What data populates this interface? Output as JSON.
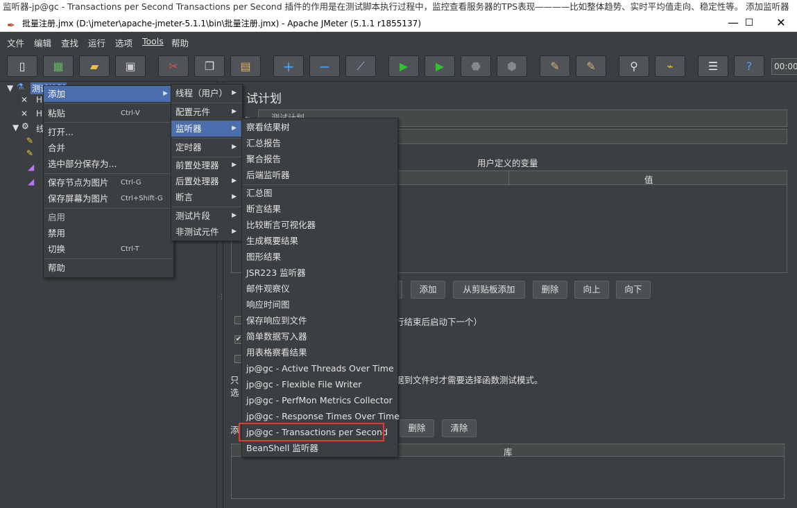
{
  "caption": "监听器-jp@gc - Transactions per Second Transactions per Second 插件的作用是在测试脚本执行过程中，监控查看服务器的TPS表现————比如整体趋势、实时平均值走向、稳定性等。 添加监听器",
  "window": {
    "title": "批量注册.jmx (D:\\jmeter\\apache-jmeter-5.1.1\\bin\\批量注册.jmx) - Apache JMeter (5.1.1 r1855137)",
    "minimize": "—",
    "maximize": "☐",
    "close": "✕"
  },
  "menubar": [
    "文件",
    "编辑",
    "查找",
    "运行",
    "选项",
    "Tools",
    "帮助"
  ],
  "toolbar": {
    "icons": [
      "new-icon",
      "templates-icon",
      "open-icon",
      "save-icon",
      "cut-icon",
      "copy-icon",
      "paste-icon",
      "expand-icon",
      "collapse-icon",
      "toggle-icon",
      "start-icon",
      "start-no-pause-icon",
      "stop-icon",
      "shutdown-icon",
      "clear-icon",
      "clear-all-icon",
      "search-icon",
      "reset-search-icon",
      "function-helper-icon",
      "help-icon"
    ],
    "timer": "00:00:"
  },
  "tree": {
    "root": "测试计划",
    "nodes": [
      "H",
      "H",
      "线",
      "",
      "",
      "",
      ""
    ]
  },
  "right": {
    "title": "试计划",
    "name_label": "名：",
    "name_value": "测试计划",
    "vars_title": "用户定义的变量",
    "vars_value_col": "值",
    "buttons": [
      "添加",
      "从剪贴板添加",
      "删除",
      "向上",
      "向下"
    ],
    "run_text": "行结束后启动下一个）",
    "func_text": "据到文件时才需要选择函数测试模式。",
    "only_char": "只",
    "select_char": "选",
    "add_char": "添",
    "lib_buttons": [
      "删除",
      "清除"
    ],
    "lib_col": "库"
  },
  "menu1": {
    "items": [
      {
        "label": "添加",
        "arrow": "▶",
        "selected": true
      },
      {
        "label": "粘贴",
        "accel": "Ctrl-V"
      },
      {
        "label": "打开..."
      },
      {
        "label": "合并"
      },
      {
        "label": "选中部分保存为..."
      },
      {
        "label": "保存节点为图片",
        "accel": "Ctrl-G"
      },
      {
        "label": "保存屏幕为图片",
        "accel": "Ctrl+Shift-G"
      },
      {
        "label": "启用",
        "dim": true
      },
      {
        "label": "禁用"
      },
      {
        "label": "切换",
        "accel": "Ctrl-T"
      },
      {
        "label": "帮助"
      }
    ]
  },
  "menu2": {
    "items": [
      {
        "label": "线程（用户）",
        "arrow": "▶"
      },
      {
        "label": "配置元件",
        "arrow": "▶"
      },
      {
        "label": "监听器",
        "arrow": "▶",
        "selected": true
      },
      {
        "label": "定时器",
        "arrow": "▶"
      },
      {
        "label": "前置处理器",
        "arrow": "▶"
      },
      {
        "label": "后置处理器",
        "arrow": "▶"
      },
      {
        "label": "断言",
        "arrow": "▶"
      },
      {
        "label": "测试片段",
        "arrow": "▶"
      },
      {
        "label": "非测试元件",
        "arrow": "▶"
      }
    ]
  },
  "menu3": {
    "items": [
      "察看结果树",
      "汇总报告",
      "聚合报告",
      "后端监听器",
      "汇总图",
      "断言结果",
      "比较断言可视化器",
      "生成概要结果",
      "图形结果",
      "JSR223 监听器",
      "邮件观察仪",
      "响应时间图",
      "保存响应到文件",
      "简单数据写入器",
      "用表格察看结果",
      "jp@gc - Active Threads Over Time",
      "jp@gc - Flexible File Writer",
      "jp@gc - PerfMon Metrics Collector",
      "jp@gc - Response Times Over Time",
      "jp@gc - Transactions per Second",
      "BeanShell 监听器"
    ]
  },
  "colors": {
    "highlight": "#e53935",
    "selection": "#4b6eaf"
  }
}
